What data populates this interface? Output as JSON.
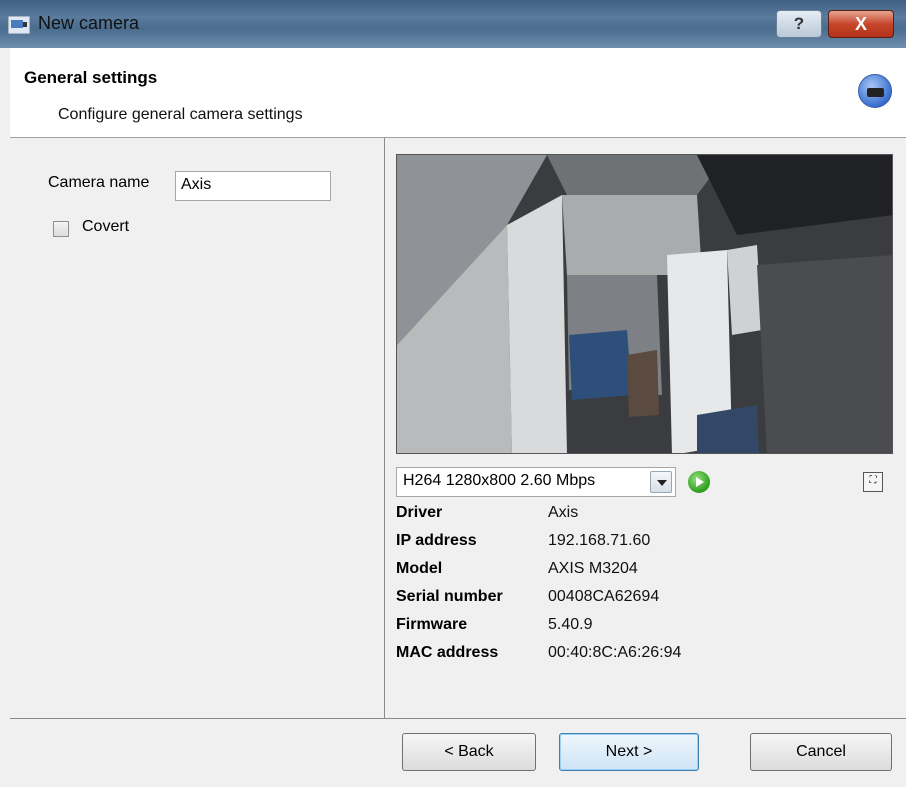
{
  "window": {
    "title": "New camera",
    "help_label": "?",
    "close_label": "X"
  },
  "header": {
    "title": "General settings",
    "subtitle": "Configure general camera settings"
  },
  "form": {
    "camera_name_label": "Camera name",
    "camera_name_value": "Axis",
    "covert_label": "Covert",
    "covert_checked": false
  },
  "stream": {
    "selected": "H264 1280x800 2.60 Mbps"
  },
  "info": [
    {
      "key": "Driver",
      "value": "Axis"
    },
    {
      "key": "IP address",
      "value": "192.168.71.60"
    },
    {
      "key": "Model",
      "value": "AXIS M3204"
    },
    {
      "key": "Serial number",
      "value": "00408CA62694"
    },
    {
      "key": "Firmware",
      "value": "5.40.9"
    },
    {
      "key": "MAC address",
      "value": "00:40:8C:A6:26:94"
    }
  ],
  "footer": {
    "back_label": "< Back",
    "next_label": "Next >",
    "cancel_label": "Cancel"
  },
  "icons": {
    "window": "camera-window-icon",
    "header": "camera-icon",
    "play": "play-icon",
    "fullscreen": "fullscreen-icon"
  }
}
